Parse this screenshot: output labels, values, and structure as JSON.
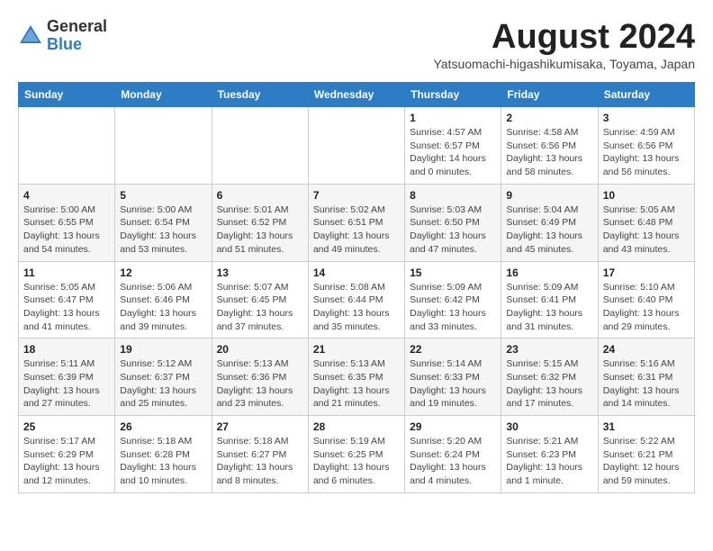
{
  "header": {
    "logo_general": "General",
    "logo_blue": "Blue",
    "month_title": "August 2024",
    "subtitle": "Yatsuomachi-higashikumisaka, Toyama, Japan"
  },
  "columns": [
    "Sunday",
    "Monday",
    "Tuesday",
    "Wednesday",
    "Thursday",
    "Friday",
    "Saturday"
  ],
  "weeks": [
    [
      {
        "day": "",
        "info": ""
      },
      {
        "day": "",
        "info": ""
      },
      {
        "day": "",
        "info": ""
      },
      {
        "day": "",
        "info": ""
      },
      {
        "day": "1",
        "info": "Sunrise: 4:57 AM\nSunset: 6:57 PM\nDaylight: 14 hours\nand 0 minutes."
      },
      {
        "day": "2",
        "info": "Sunrise: 4:58 AM\nSunset: 6:56 PM\nDaylight: 13 hours\nand 58 minutes."
      },
      {
        "day": "3",
        "info": "Sunrise: 4:59 AM\nSunset: 6:56 PM\nDaylight: 13 hours\nand 56 minutes."
      }
    ],
    [
      {
        "day": "4",
        "info": "Sunrise: 5:00 AM\nSunset: 6:55 PM\nDaylight: 13 hours\nand 54 minutes."
      },
      {
        "day": "5",
        "info": "Sunrise: 5:00 AM\nSunset: 6:54 PM\nDaylight: 13 hours\nand 53 minutes."
      },
      {
        "day": "6",
        "info": "Sunrise: 5:01 AM\nSunset: 6:52 PM\nDaylight: 13 hours\nand 51 minutes."
      },
      {
        "day": "7",
        "info": "Sunrise: 5:02 AM\nSunset: 6:51 PM\nDaylight: 13 hours\nand 49 minutes."
      },
      {
        "day": "8",
        "info": "Sunrise: 5:03 AM\nSunset: 6:50 PM\nDaylight: 13 hours\nand 47 minutes."
      },
      {
        "day": "9",
        "info": "Sunrise: 5:04 AM\nSunset: 6:49 PM\nDaylight: 13 hours\nand 45 minutes."
      },
      {
        "day": "10",
        "info": "Sunrise: 5:05 AM\nSunset: 6:48 PM\nDaylight: 13 hours\nand 43 minutes."
      }
    ],
    [
      {
        "day": "11",
        "info": "Sunrise: 5:05 AM\nSunset: 6:47 PM\nDaylight: 13 hours\nand 41 minutes."
      },
      {
        "day": "12",
        "info": "Sunrise: 5:06 AM\nSunset: 6:46 PM\nDaylight: 13 hours\nand 39 minutes."
      },
      {
        "day": "13",
        "info": "Sunrise: 5:07 AM\nSunset: 6:45 PM\nDaylight: 13 hours\nand 37 minutes."
      },
      {
        "day": "14",
        "info": "Sunrise: 5:08 AM\nSunset: 6:44 PM\nDaylight: 13 hours\nand 35 minutes."
      },
      {
        "day": "15",
        "info": "Sunrise: 5:09 AM\nSunset: 6:42 PM\nDaylight: 13 hours\nand 33 minutes."
      },
      {
        "day": "16",
        "info": "Sunrise: 5:09 AM\nSunset: 6:41 PM\nDaylight: 13 hours\nand 31 minutes."
      },
      {
        "day": "17",
        "info": "Sunrise: 5:10 AM\nSunset: 6:40 PM\nDaylight: 13 hours\nand 29 minutes."
      }
    ],
    [
      {
        "day": "18",
        "info": "Sunrise: 5:11 AM\nSunset: 6:39 PM\nDaylight: 13 hours\nand 27 minutes."
      },
      {
        "day": "19",
        "info": "Sunrise: 5:12 AM\nSunset: 6:37 PM\nDaylight: 13 hours\nand 25 minutes."
      },
      {
        "day": "20",
        "info": "Sunrise: 5:13 AM\nSunset: 6:36 PM\nDaylight: 13 hours\nand 23 minutes."
      },
      {
        "day": "21",
        "info": "Sunrise: 5:13 AM\nSunset: 6:35 PM\nDaylight: 13 hours\nand 21 minutes."
      },
      {
        "day": "22",
        "info": "Sunrise: 5:14 AM\nSunset: 6:33 PM\nDaylight: 13 hours\nand 19 minutes."
      },
      {
        "day": "23",
        "info": "Sunrise: 5:15 AM\nSunset: 6:32 PM\nDaylight: 13 hours\nand 17 minutes."
      },
      {
        "day": "24",
        "info": "Sunrise: 5:16 AM\nSunset: 6:31 PM\nDaylight: 13 hours\nand 14 minutes."
      }
    ],
    [
      {
        "day": "25",
        "info": "Sunrise: 5:17 AM\nSunset: 6:29 PM\nDaylight: 13 hours\nand 12 minutes."
      },
      {
        "day": "26",
        "info": "Sunrise: 5:18 AM\nSunset: 6:28 PM\nDaylight: 13 hours\nand 10 minutes."
      },
      {
        "day": "27",
        "info": "Sunrise: 5:18 AM\nSunset: 6:27 PM\nDaylight: 13 hours\nand 8 minutes."
      },
      {
        "day": "28",
        "info": "Sunrise: 5:19 AM\nSunset: 6:25 PM\nDaylight: 13 hours\nand 6 minutes."
      },
      {
        "day": "29",
        "info": "Sunrise: 5:20 AM\nSunset: 6:24 PM\nDaylight: 13 hours\nand 4 minutes."
      },
      {
        "day": "30",
        "info": "Sunrise: 5:21 AM\nSunset: 6:23 PM\nDaylight: 13 hours\nand 1 minute."
      },
      {
        "day": "31",
        "info": "Sunrise: 5:22 AM\nSunset: 6:21 PM\nDaylight: 12 hours\nand 59 minutes."
      }
    ]
  ]
}
